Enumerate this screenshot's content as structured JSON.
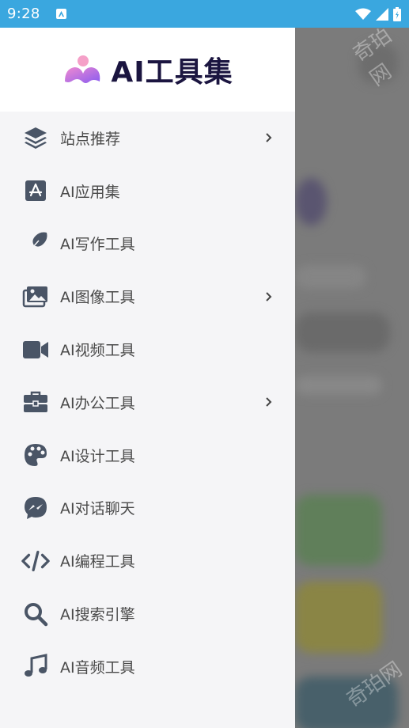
{
  "status_bar": {
    "time": "9:28"
  },
  "app": {
    "title": "AI工具集"
  },
  "menu": [
    {
      "label": "站点推荐",
      "icon": "layers-icon",
      "has_submenu": true
    },
    {
      "label": "AI应用集",
      "icon": "app-store-icon",
      "has_submenu": false
    },
    {
      "label": "AI写作工具",
      "icon": "feather-icon",
      "has_submenu": false
    },
    {
      "label": "AI图像工具",
      "icon": "images-icon",
      "has_submenu": true
    },
    {
      "label": "AI视频工具",
      "icon": "video-camera-icon",
      "has_submenu": false
    },
    {
      "label": "AI办公工具",
      "icon": "briefcase-icon",
      "has_submenu": true
    },
    {
      "label": "AI设计工具",
      "icon": "palette-icon",
      "has_submenu": false
    },
    {
      "label": "AI对话聊天",
      "icon": "messenger-icon",
      "has_submenu": false
    },
    {
      "label": "AI编程工具",
      "icon": "code-icon",
      "has_submenu": false
    },
    {
      "label": "AI搜索引擎",
      "icon": "search-icon",
      "has_submenu": false
    },
    {
      "label": "AI音频工具",
      "icon": "music-note-icon",
      "has_submenu": false
    }
  ],
  "colors": {
    "status_bar": "#3aa7df",
    "drawer_bg": "#f5f5f7",
    "icon": "#4a5566",
    "label": "#4a4a4a",
    "logo_dark": "#1b1540"
  },
  "watermark": "奇珀网"
}
